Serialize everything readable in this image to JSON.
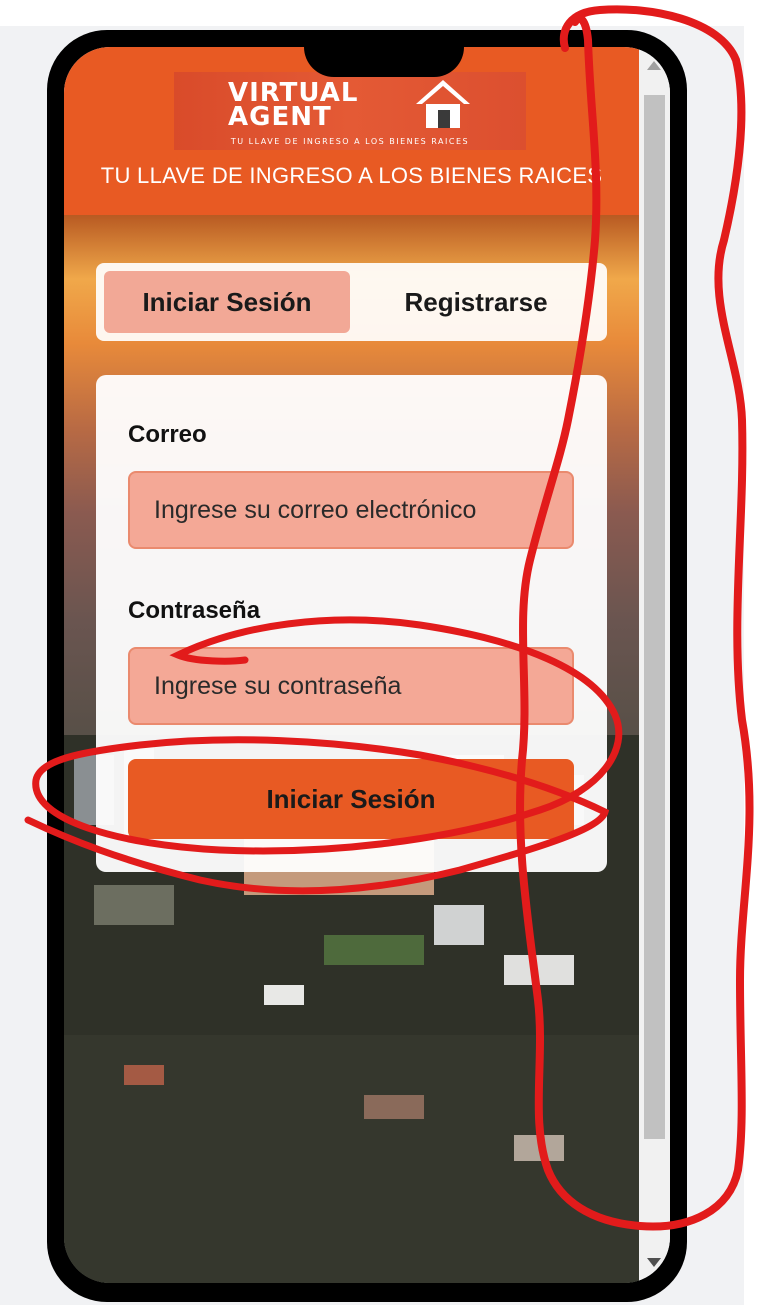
{
  "header": {
    "logo_line1": "VIRTUAL",
    "logo_line2": "AGENT",
    "logo_tagline": "TU LLAVE DE INGRESO A LOS BIENES RAICES",
    "subtitle": "TU LLAVE DE INGRESO A LOS BIENES RAICES"
  },
  "tabs": [
    {
      "label": "Iniciar Sesión",
      "active": true
    },
    {
      "label": "Registrarse",
      "active": false
    }
  ],
  "form": {
    "email_label": "Correo",
    "email_placeholder": "Ingrese su correo electrónico",
    "password_label": "Contraseña",
    "password_placeholder": "Ingrese su contraseña",
    "submit_label": "Iniciar Sesión"
  },
  "colors": {
    "brand_orange": "#e85a23",
    "input_fill": "#f4a896",
    "annotation_red": "#e21b1b"
  },
  "icons": [
    "house-icon",
    "scroll-up-arrow-icon",
    "scroll-down-arrow-icon"
  ]
}
